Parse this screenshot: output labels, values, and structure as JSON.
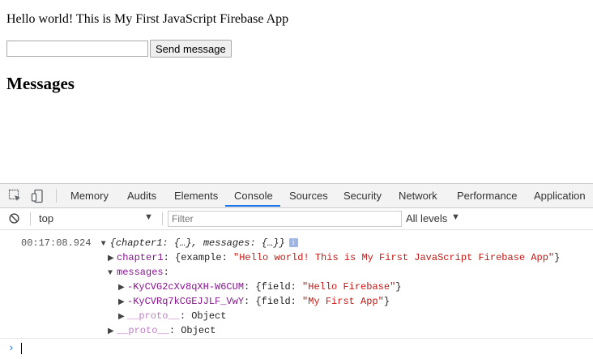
{
  "page": {
    "intro_text": "Hello world! This is My First JavaScript Firebase App",
    "input_value": "",
    "send_label": "Send message",
    "messages_heading": "Messages"
  },
  "devtools": {
    "tabs": [
      {
        "label": "Memory"
      },
      {
        "label": "Audits"
      },
      {
        "label": "Elements"
      },
      {
        "label": "Console",
        "active": true
      },
      {
        "label": "Sources"
      },
      {
        "label": "Security"
      },
      {
        "label": "Network"
      },
      {
        "label": "Performance"
      },
      {
        "label": "Application"
      }
    ],
    "context": "top",
    "filter_placeholder": "Filter",
    "levels": "All levels",
    "accent": "#1a73e8"
  },
  "console": {
    "timestamp": "00:17:08.924",
    "summary": "{chapter1: {…}, messages: {…}}",
    "info_badge": "i",
    "chapter1_key": "chapter1",
    "chapter1_open": ": {example: ",
    "chapter1_value": "\"Hello world! This is My First JavaScript Firebase App\"",
    "chapter1_close": "}",
    "messages_key": "messages",
    "messages_colon": ":",
    "msg1_key": "-KyCVG2cXv8qXH-W6CUM",
    "msg1_open": ": {field: ",
    "msg1_value": "\"Hello Firebase\"",
    "msg1_close": "}",
    "msg2_key": "-KyCVRq7kCGEJJLF_VwY",
    "msg2_open": ": {field: ",
    "msg2_value": "\"My First App\"",
    "msg2_close": "}",
    "proto_key": "__proto__",
    "proto_value": ": Object"
  }
}
